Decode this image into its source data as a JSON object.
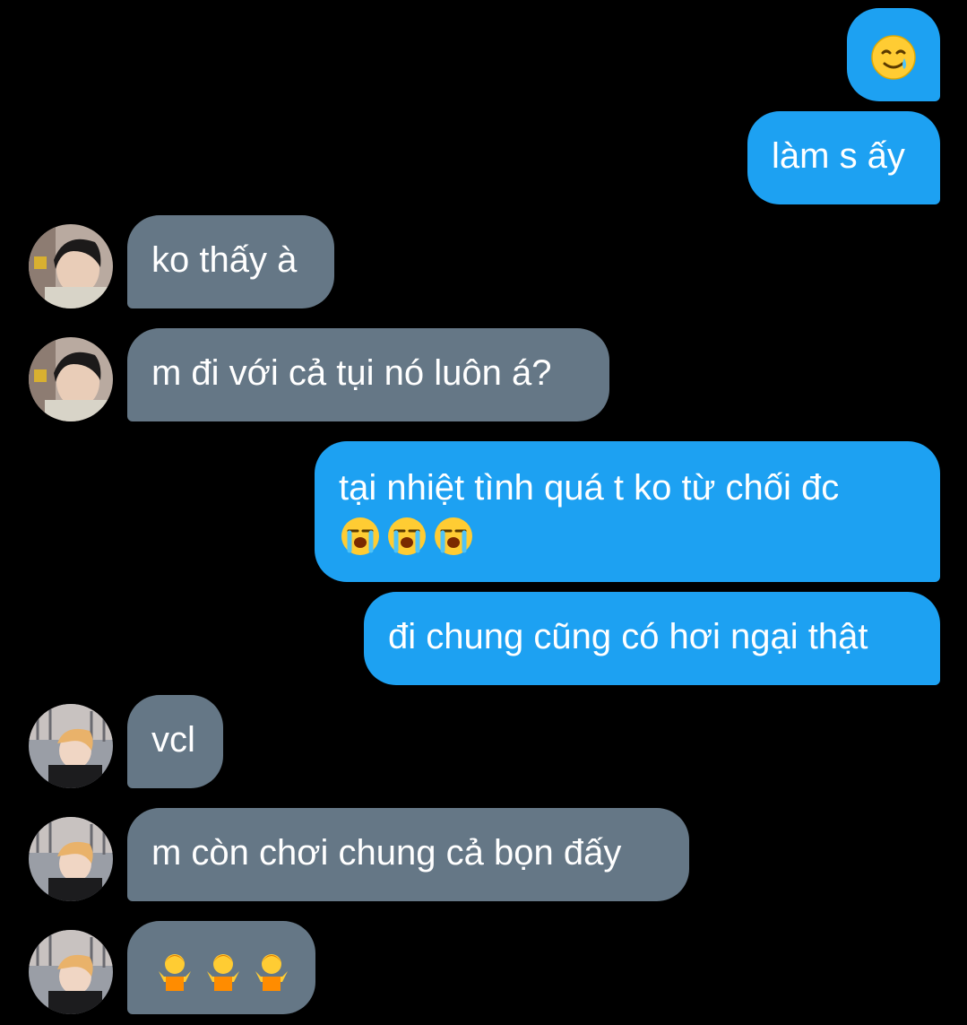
{
  "conversation": {
    "messages": [
      {
        "id": "m1",
        "from": "me",
        "text": "",
        "emoji": "smiling-face-with-tear"
      },
      {
        "id": "m2",
        "from": "me",
        "text": "làm s ấy"
      },
      {
        "id": "m3",
        "from": "friend-a",
        "text": "ko thấy à"
      },
      {
        "id": "m4",
        "from": "friend-a",
        "text": "m đi với cả tụi nó luôn á?"
      },
      {
        "id": "m5",
        "from": "me",
        "text": "tại nhiệt tình quá t ko từ chối đc",
        "emoji": "loudly-crying-face x3"
      },
      {
        "id": "m6",
        "from": "me",
        "text": "đi chung cũng có hơi ngại thật"
      },
      {
        "id": "m7",
        "from": "friend-b",
        "text": "vcl"
      },
      {
        "id": "m8",
        "from": "friend-b",
        "text": "m còn chơi chung cả bọn đấy"
      },
      {
        "id": "m9",
        "from": "friend-b",
        "text": "",
        "emoji": "person-shrugging x3"
      }
    ]
  },
  "colors": {
    "background": "#000000",
    "outgoing_bubble": "#1DA1F2",
    "incoming_bubble": "#657786",
    "text": "#FFFFFF"
  }
}
